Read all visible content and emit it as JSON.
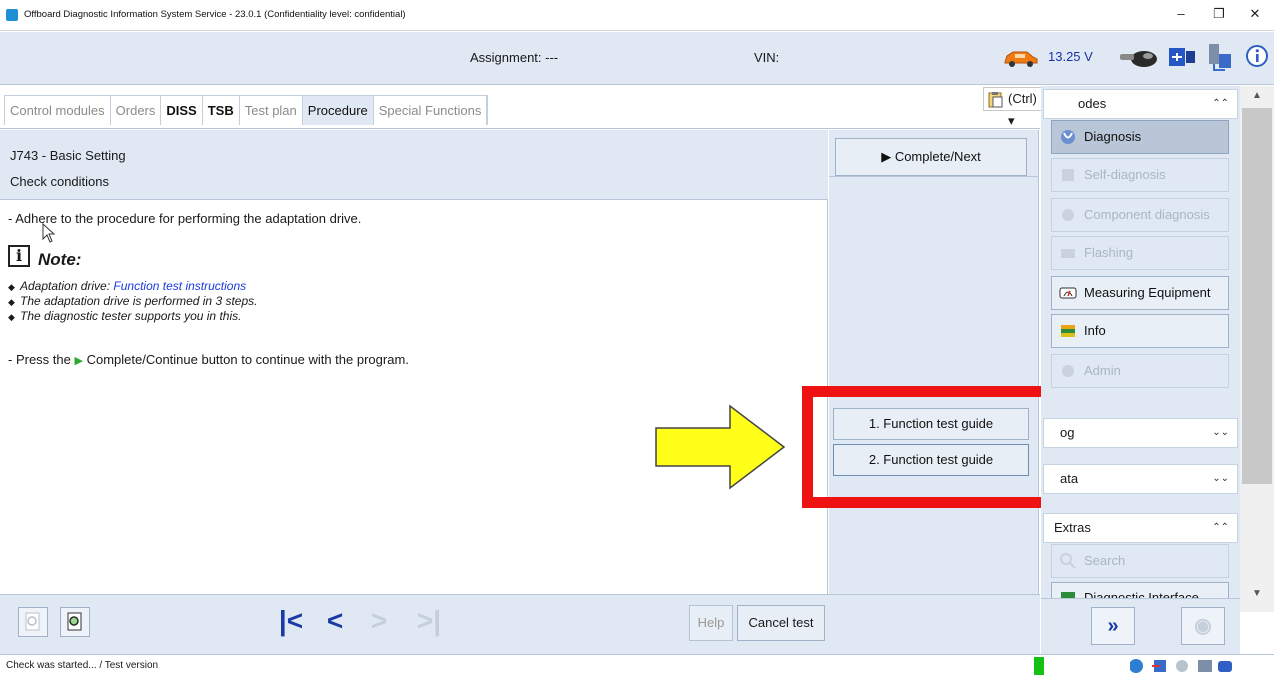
{
  "window": {
    "title": "Offboard Diagnostic Information System Service - 23.0.1 (Confidentiality level: confidential)",
    "minimize": "–",
    "maximize": "❐",
    "close": "✕"
  },
  "header": {
    "assignment": "Assignment: ---",
    "vin": "VIN:",
    "voltage": "13.25 V"
  },
  "tabs": [
    {
      "label": "Control modules"
    },
    {
      "label": "Orders"
    },
    {
      "label": "DISS"
    },
    {
      "label": "TSB"
    },
    {
      "label": "Test plan"
    },
    {
      "label": "Procedure"
    },
    {
      "label": "Special Functions"
    }
  ],
  "paste_popup": {
    "label": "(Ctrl) ▾"
  },
  "procedure": {
    "title": "J743 - Basic Setting",
    "subtitle": "Check conditions",
    "line1": "- Adhere to the procedure for performing the adaptation drive.",
    "note_title": "Note:",
    "bullet1_prefix": "Adaptation drive: ",
    "bullet1_link": "Function test instructions",
    "bullet2": "The adaptation drive is performed in 3 steps.",
    "bullet3": "The diagnostic tester supports you in this.",
    "press_prefix": "- Press the",
    "press_suffix": "Complete/Continue button to continue with the program."
  },
  "actions": {
    "complete_next": "▶  Complete/Next",
    "function_test_1": "1. Function test guide",
    "function_test_2": "2. Function test guide"
  },
  "toolbar": {
    "help": "Help",
    "cancel": "Cancel test"
  },
  "status": {
    "text": "Check was started... / Test version"
  },
  "right_panel": {
    "modes_header": "odes",
    "modes": [
      {
        "label": "Diagnosis"
      },
      {
        "label": "Self-diagnosis"
      },
      {
        "label": "Component diagnosis"
      },
      {
        "label": "Flashing"
      },
      {
        "label": "Measuring Equipment"
      },
      {
        "label": "Info"
      },
      {
        "label": "Admin"
      }
    ],
    "log_header": "og",
    "data_header": "ata",
    "extras_header": "Extras",
    "extras": [
      {
        "label": "Search"
      },
      {
        "label": "Diagnostic Interface"
      }
    ]
  },
  "colors": {
    "panel_bg": "#dfe8f3",
    "link": "#1a3ae0",
    "annotation_red": "#ee1212",
    "annotation_yellow": "#ffff1a",
    "status_green": "#13c013"
  }
}
